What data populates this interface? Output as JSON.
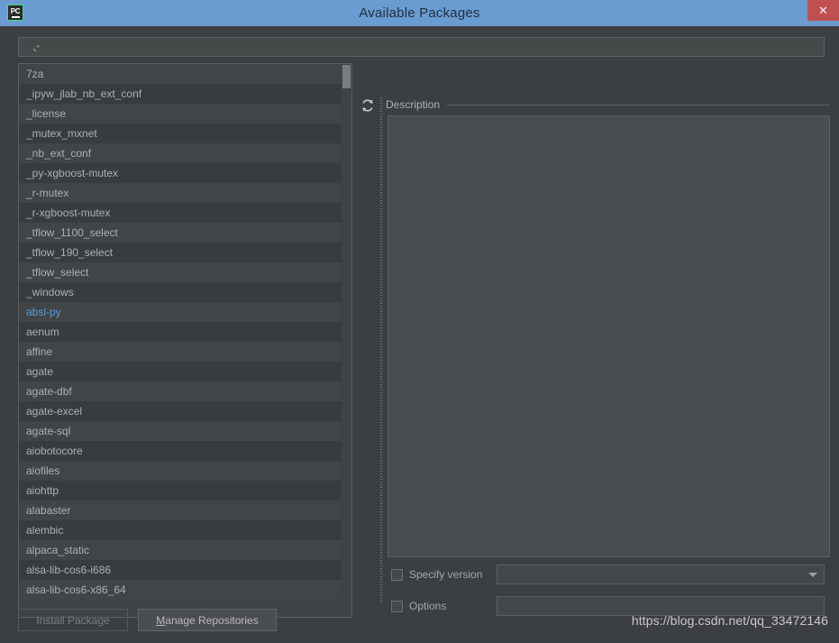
{
  "window": {
    "title": "Available Packages",
    "app_icon": "pycharm-icon",
    "close_label": "✕"
  },
  "search": {
    "icon": "search-icon",
    "value": "",
    "placeholder": ""
  },
  "packages": {
    "selected": "absl-py",
    "items": [
      "7za",
      "_ipyw_jlab_nb_ext_conf",
      "_license",
      "_mutex_mxnet",
      "_nb_ext_conf",
      "_py-xgboost-mutex",
      "_r-mutex",
      "_r-xgboost-mutex",
      "_tflow_1100_select",
      "_tflow_190_select",
      "_tflow_select",
      "_windows",
      "absl-py",
      "aenum",
      "affine",
      "agate",
      "agate-dbf",
      "agate-excel",
      "agate-sql",
      "aiobotocore",
      "aiofiles",
      "aiohttp",
      "alabaster",
      "alembic",
      "alpaca_static",
      "alsa-lib-cos6-i686",
      "alsa-lib-cos6-x86_64"
    ]
  },
  "toolbar": {
    "refresh_icon": "refresh-icon"
  },
  "description": {
    "label": "Description",
    "body": ""
  },
  "options": {
    "specify_version_label": "Specify version",
    "specify_version_checked": false,
    "version_value": "",
    "options_label": "Options",
    "options_checked": false,
    "options_value": ""
  },
  "footer": {
    "install_label": "Install Package",
    "install_enabled": false,
    "manage_mnemonic": "M",
    "manage_label": "anage Repositories",
    "watermark": "https://blog.csdn.net/qq_33472146"
  },
  "colors": {
    "titlebar": "#6a9bd1",
    "close": "#c05050",
    "selection_text": "#5b9bd5",
    "background": "#3c3f41",
    "row_odd": "#414548",
    "row_even": "#393c3f"
  }
}
